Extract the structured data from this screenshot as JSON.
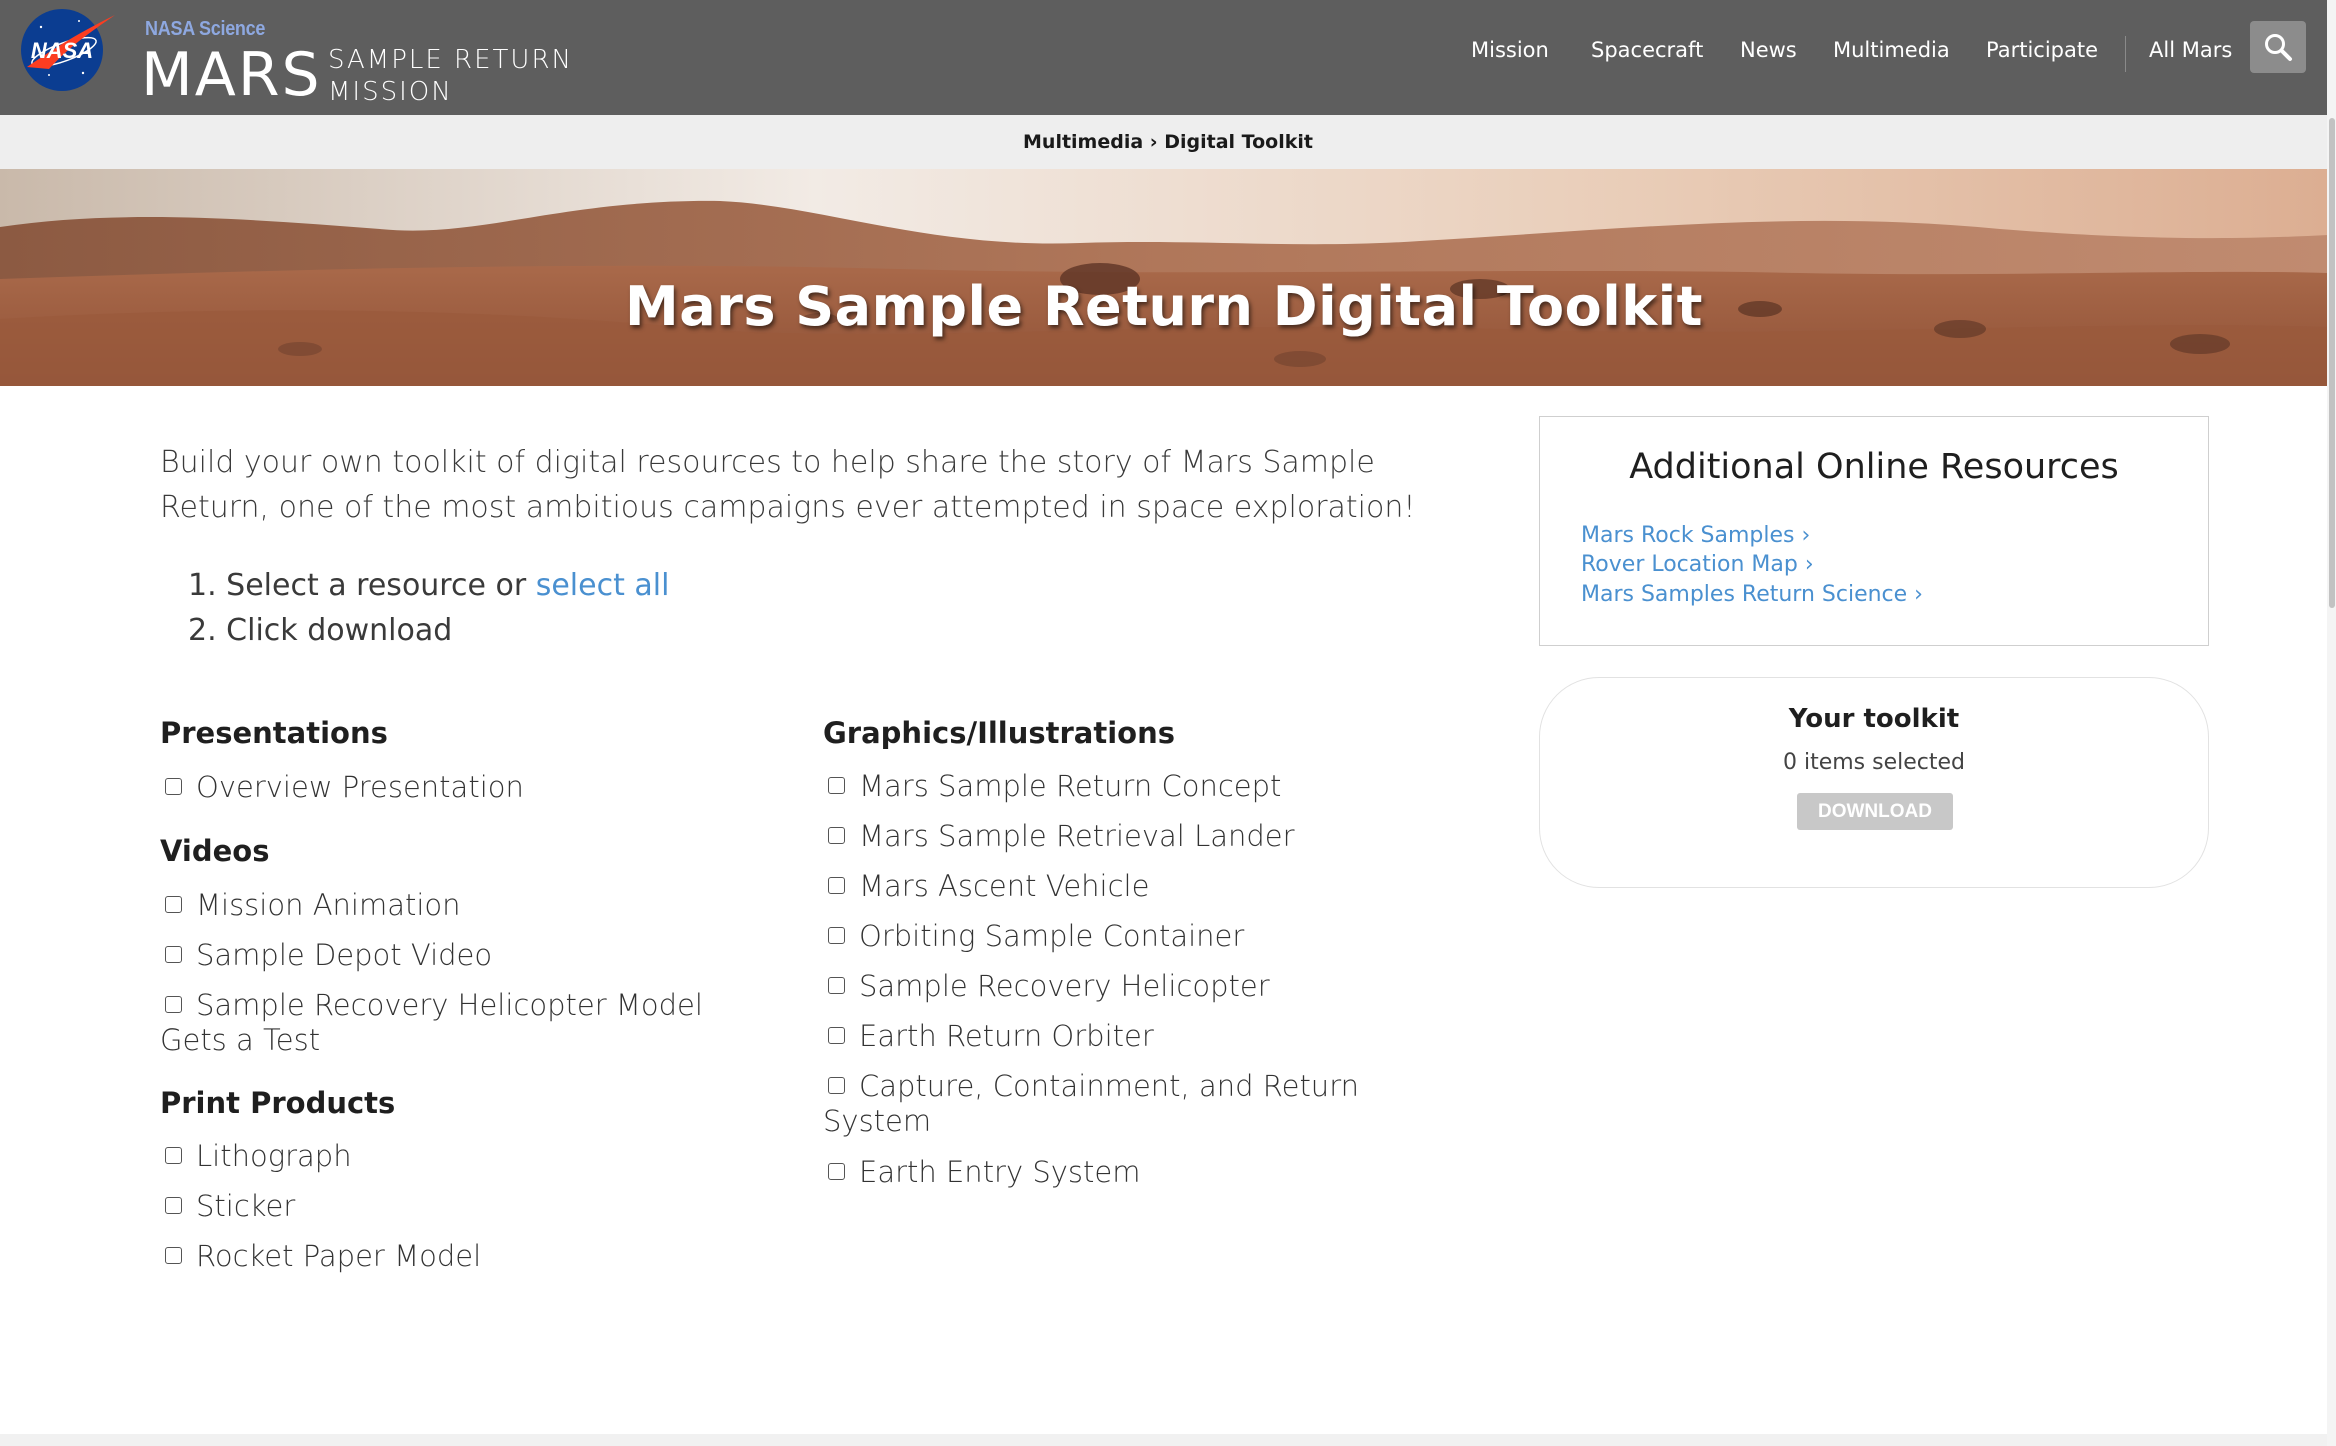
{
  "header": {
    "nasa_logo_text": "NASA",
    "nasa_science": "NASA Science",
    "mars": "MARS",
    "subtitle_line1": "SAMPLE RETURN",
    "subtitle_line2": "MISSION",
    "nav": [
      "Mission",
      "Spacecraft",
      "News",
      "Multimedia",
      "Participate",
      "All Mars"
    ],
    "search_icon": "search-icon"
  },
  "breadcrumb": {
    "parent": "Multimedia",
    "separator": " › ",
    "current": "Digital Toolkit"
  },
  "hero": {
    "title": "Mars Sample Return Digital Toolkit"
  },
  "intro": {
    "text": "Build your own toolkit of digital resources to help share the story of Mars Sample Return, one of the most ambitious campaigns ever attempted in space exploration!",
    "step1_num": "1.",
    "step1_text": "Select a resource or ",
    "step1_link": "select all",
    "step2_num": "2.",
    "step2_text": "Click download"
  },
  "sections": {
    "presentations": {
      "title": "Presentations",
      "items": [
        "Overview Presentation"
      ]
    },
    "videos": {
      "title": "Videos",
      "items": [
        "Mission Animation",
        "Sample Depot Video",
        "Sample Recovery Helicopter Model Gets a Test"
      ]
    },
    "print": {
      "title": "Print Products",
      "items": [
        "Lithograph",
        "Sticker",
        "Rocket Paper Model"
      ]
    },
    "graphics": {
      "title": "Graphics/Illustrations",
      "items": [
        "Mars Sample Return Concept",
        "Mars Sample Retrieval Lander",
        "Mars Ascent Vehicle",
        "Orbiting Sample Container",
        "Sample Recovery Helicopter",
        "Earth Return Orbiter",
        "Capture, Containment, and Return System",
        "Earth Entry System"
      ]
    }
  },
  "resources": {
    "title": "Additional Online Resources",
    "links": [
      "Mars Rock Samples ›",
      "Rover Location Map ›",
      "Mars Samples Return Science ›"
    ]
  },
  "toolkit": {
    "title": "Your toolkit",
    "count": "0 items selected",
    "button": "DOWNLOAD"
  },
  "colors": {
    "header_bg": "#5e5e5e",
    "link": "#4a90d0",
    "nasa_blue": "#0b3d91",
    "nasa_red": "#fc3d21"
  }
}
